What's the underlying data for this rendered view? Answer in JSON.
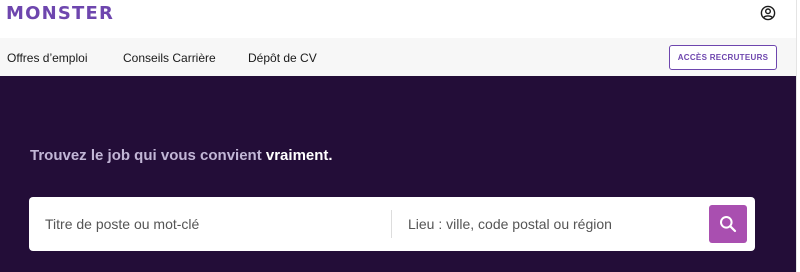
{
  "header": {
    "logo_text": "MONSTER",
    "account_icon": "account-circle-icon",
    "brand_color": "#6e46ae"
  },
  "nav": {
    "items": [
      {
        "label": "Offres d’emploi"
      },
      {
        "label": "Conseils Carrière"
      },
      {
        "label": "Dépôt de CV"
      }
    ],
    "recruiter_label": "ACCÈS RECRUTEURS"
  },
  "hero": {
    "background": "#230d38",
    "tagline_main": "Trouvez le job qui vous convient ",
    "tagline_strong": "vraiment."
  },
  "search": {
    "keyword_placeholder": "Titre de poste ou mot-clé",
    "location_placeholder": "Lieu : ville, code postal ou région",
    "button_icon": "search-icon",
    "button_color": "#a94fb0"
  }
}
